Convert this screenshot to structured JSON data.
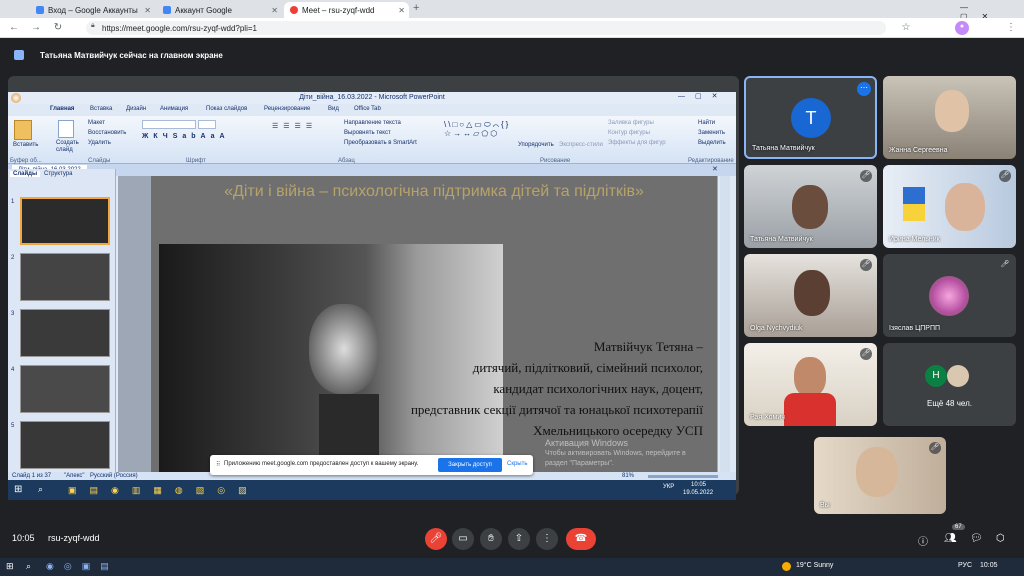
{
  "browser": {
    "tabs": [
      {
        "label": "Вход – Google Аккаунты",
        "fav": "#4285f4"
      },
      {
        "label": "Аккаунт Google",
        "fav": "#4285f4"
      },
      {
        "label": "Meet – rsu-zyqf-wdd",
        "fav": "#ea4335"
      }
    ],
    "new_tab": "+",
    "url": "https://meet.google.com/rsu-zyqf-wdd?pli=1"
  },
  "meet": {
    "presenting_text": "Татьяна Матвийчук сейчас на главном экране",
    "time": "10:05",
    "meeting_code": "rsu-zyqf-wdd",
    "people_count": "67",
    "participants": [
      {
        "name": "Татьяна Матвийчук",
        "avatar": "T"
      },
      {
        "name": "Жанна Сергеевна"
      },
      {
        "name": "Татьяна Матвийчук"
      },
      {
        "name": "Ирина Мельник"
      },
      {
        "name": "Olga Nychvydiuk"
      },
      {
        "name": "Ізяслав ЦПРПП"
      },
      {
        "name": "Рая Хомич"
      },
      {
        "name": "Ещё 48 чел.",
        "avatar": "Н"
      },
      {
        "name": "Вы"
      }
    ],
    "notice": {
      "text": "Приложению meet.google.com предоставлен доступ к вашему экрану.",
      "stop": "Закрыть доступ",
      "hide": "Скрыть"
    }
  },
  "ppt": {
    "title": "Діти_війна_16.03.2022 - Microsoft PowerPoint",
    "ribbon_tabs": [
      "Главная",
      "Вставка",
      "Дизайн",
      "Анимация",
      "Показ слайдов",
      "Рецензирование",
      "Вид",
      "Office Tab"
    ],
    "groups": [
      "Буфер об...",
      "Слайды",
      "Шрифт",
      "Абзац",
      "Рисование",
      "Редактирование"
    ],
    "buttons": [
      "Вставить",
      "Создать слайд",
      "Макет",
      "Восстановить",
      "Удалить",
      "Направление текста",
      "Выровнять текст",
      "Преобразовать в SmartArt",
      "Упорядочить",
      "Экспресс-стили",
      "Заливка фигуры",
      "Контур фигуры",
      "Эффекты для фигур",
      "Найти",
      "Заменить",
      "Выделить"
    ],
    "doc_tab": "Діти_війна_16.03.2022",
    "pane_tabs": [
      "Слайды",
      "Структура"
    ],
    "slide_numbers": [
      "1",
      "2",
      "3",
      "4",
      "5"
    ],
    "slide_title": "«Діти і війна – психологічна підтримка дітей та підлітків»",
    "slide_author": "Матвійчук Тетяна –",
    "slide_lines": [
      "дитячий, підлітковий, сімейний психолог,",
      "кандидат психологічних наук, доцент,",
      "представник секції дитячої та юнацької психотерапії",
      "Хмельницького осередку УСП"
    ],
    "watermark1": "Активация Windows",
    "watermark2": "Чтобы активировать Windows, перейдите в",
    "watermark3": "раздел \"Параметры\".",
    "status": {
      "slide": "Слайд 1 из 37",
      "theme": "\"Апекс\"",
      "lang": "Русский (Россия)",
      "zoom": "81%"
    },
    "tray": {
      "lang": "УКР",
      "time": "10:05",
      "date": "19.05.2022"
    }
  },
  "windows": {
    "weather": "19°C  Sunny",
    "lang": "РУС",
    "time": "10:05"
  }
}
